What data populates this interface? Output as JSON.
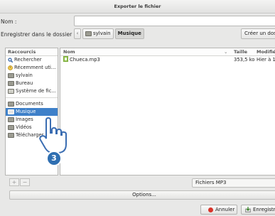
{
  "window": {
    "title": "Exporter le fichier"
  },
  "name_row": {
    "label": "Nom :",
    "value": ""
  },
  "folder_row": {
    "label": "Enregistrer dans le dossier :",
    "path": [
      "sylvain",
      "Musique"
    ],
    "create_folder": "Créer un dossi"
  },
  "places": {
    "header": "Raccourcis",
    "items": [
      {
        "label": "Rechercher",
        "icon": "search-icon"
      },
      {
        "label": "Récemment uti...",
        "icon": "recent-icon"
      },
      {
        "label": "sylvain",
        "icon": "folder-icon"
      },
      {
        "label": "Bureau",
        "icon": "folder-icon"
      },
      {
        "label": "Système de fic...",
        "icon": "drive-icon"
      },
      {
        "label": "Documents",
        "icon": "folder-icon"
      },
      {
        "label": "Musique",
        "icon": "folder-icon",
        "selected": true
      },
      {
        "label": "Images",
        "icon": "folder-icon"
      },
      {
        "label": "Vidéos",
        "icon": "folder-icon"
      },
      {
        "label": "Télécharger",
        "icon": "folder-icon"
      }
    ]
  },
  "files": {
    "headers": {
      "name": "Nom",
      "size": "Taille",
      "modified": "Modifié"
    },
    "rows": [
      {
        "name": "Chueca.mp3",
        "size": "353,5 ko",
        "modified": "Hier à 10:",
        "icon": "audio-file-icon"
      }
    ]
  },
  "filter": {
    "value": "Fichiers MP3"
  },
  "options_label": "Options...",
  "buttons": {
    "cancel": "Annuler",
    "save": "Enregistre"
  },
  "overlay": {
    "step_number": "3"
  },
  "colors": {
    "selection": "#3e80c9",
    "badge": "#2f6fb1"
  }
}
